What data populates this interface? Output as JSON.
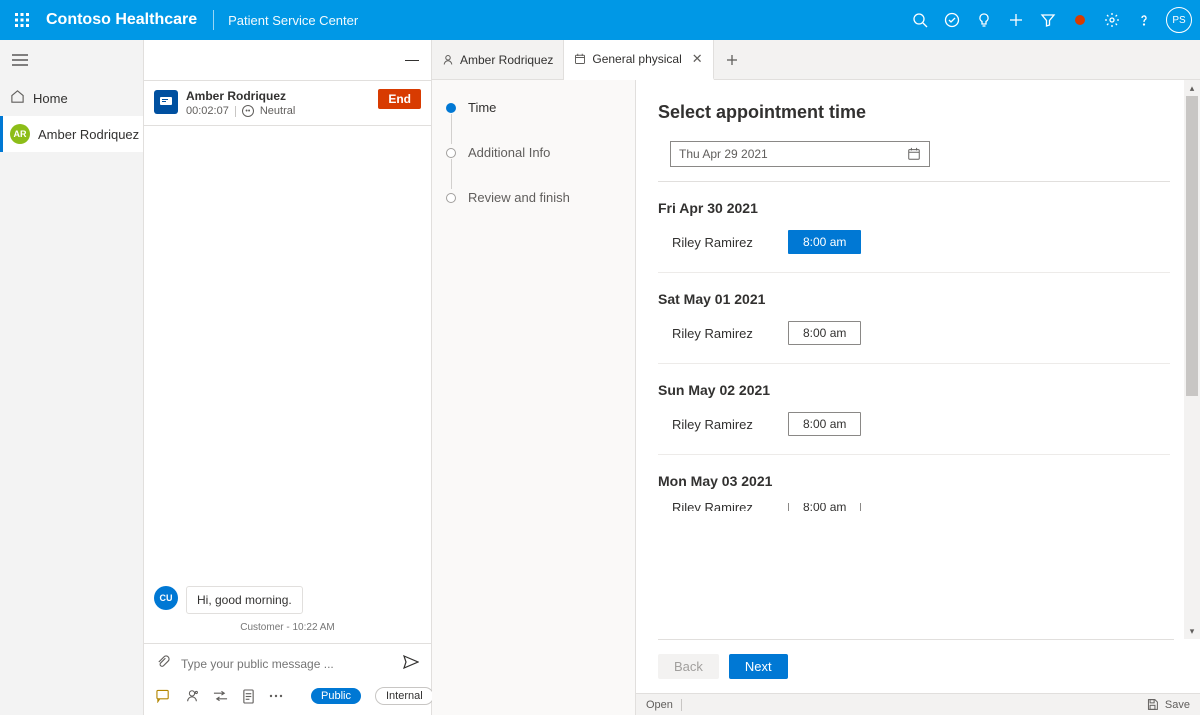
{
  "header": {
    "brand": "Contoso Healthcare",
    "sub": "Patient Service Center",
    "avatar": "PS"
  },
  "sidebar": {
    "home": "Home",
    "session_initials": "AR",
    "session_name": "Amber Rodriquez"
  },
  "conversation": {
    "name": "Amber Rodriquez",
    "timer": "00:02:07",
    "sentiment": "Neutral",
    "end_label": "End"
  },
  "chat": {
    "customer_initials": "CU",
    "message": "Hi, good morning.",
    "meta": "Customer - 10:22 AM",
    "placeholder": "Type your public message ...",
    "public_label": "Public",
    "internal_label": "Internal"
  },
  "tabs": {
    "person": "Amber Rodriquez",
    "active": "General physical"
  },
  "steps": {
    "s1": "Time",
    "s2": "Additional Info",
    "s3": "Review and finish"
  },
  "detail": {
    "title": "Select appointment time",
    "date": "Thu Apr 29 2021",
    "days": [
      {
        "label": "Fri Apr 30 2021",
        "provider": "Riley Ramirez",
        "slot": "8:00 am",
        "selected": true
      },
      {
        "label": "Sat May 01 2021",
        "provider": "Riley Ramirez",
        "slot": "8:00 am",
        "selected": false
      },
      {
        "label": "Sun May 02 2021",
        "provider": "Riley Ramirez",
        "slot": "8:00 am",
        "selected": false
      },
      {
        "label": "Mon May 03 2021",
        "provider": "Riley Ramirez",
        "slot": "8:00 am",
        "selected": false
      }
    ],
    "back": "Back",
    "next": "Next"
  },
  "status": {
    "open": "Open",
    "save": "Save"
  }
}
